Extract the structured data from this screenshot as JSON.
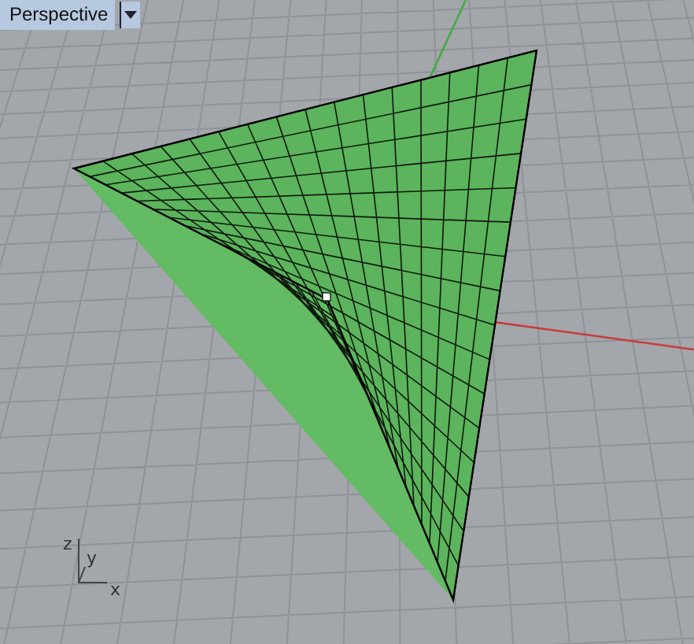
{
  "viewport": {
    "title": "Perspective"
  },
  "axis_gizmo": {
    "labels": [
      "z",
      "y",
      "x"
    ]
  }
}
